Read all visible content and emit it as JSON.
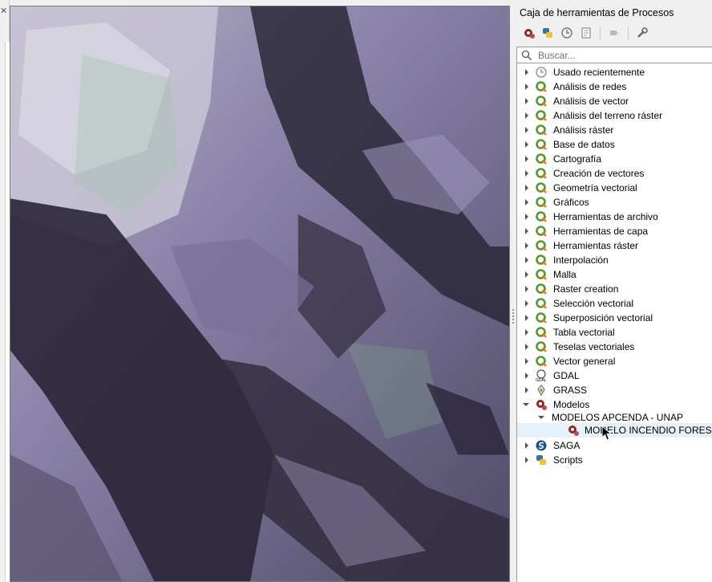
{
  "toolbox": {
    "title": "Caja de herramientas de Procesos",
    "search_placeholder": "Buscar..."
  },
  "toolbar": {
    "icons": [
      "models-icon",
      "python-icon",
      "history-icon",
      "results-icon",
      "edit-feature-icon",
      "options-icon"
    ]
  },
  "tree": {
    "recent": "Usado recientemente",
    "items": [
      "Análisis de redes",
      "Análisis de vector",
      "Análisis del terreno ráster",
      "Análisis ráster",
      "Base de datos",
      "Cartografía",
      "Creación de vectores",
      "Geometría vectorial",
      "Gráficos",
      "Herramientas de archivo",
      "Herramientas de capa",
      "Herramientas ráster",
      "Interpolación",
      "Malla",
      "Raster creation",
      "Selección vectorial",
      "Superposición vectorial",
      "Tabla vectorial",
      "Teselas vectoriales",
      "Vector general"
    ],
    "gdal": "GDAL",
    "grass": "GRASS",
    "models": "Modelos",
    "model_group": "MODELOS APCENDA - UNAP",
    "model_item": "MODELO INCENDIO FORESTAL",
    "saga": "SAGA",
    "scripts": "Scripts"
  },
  "colors": {
    "qgis_green": "#589632",
    "qgis_yellow": "#ee7913",
    "selection": "#e5f1fb"
  }
}
